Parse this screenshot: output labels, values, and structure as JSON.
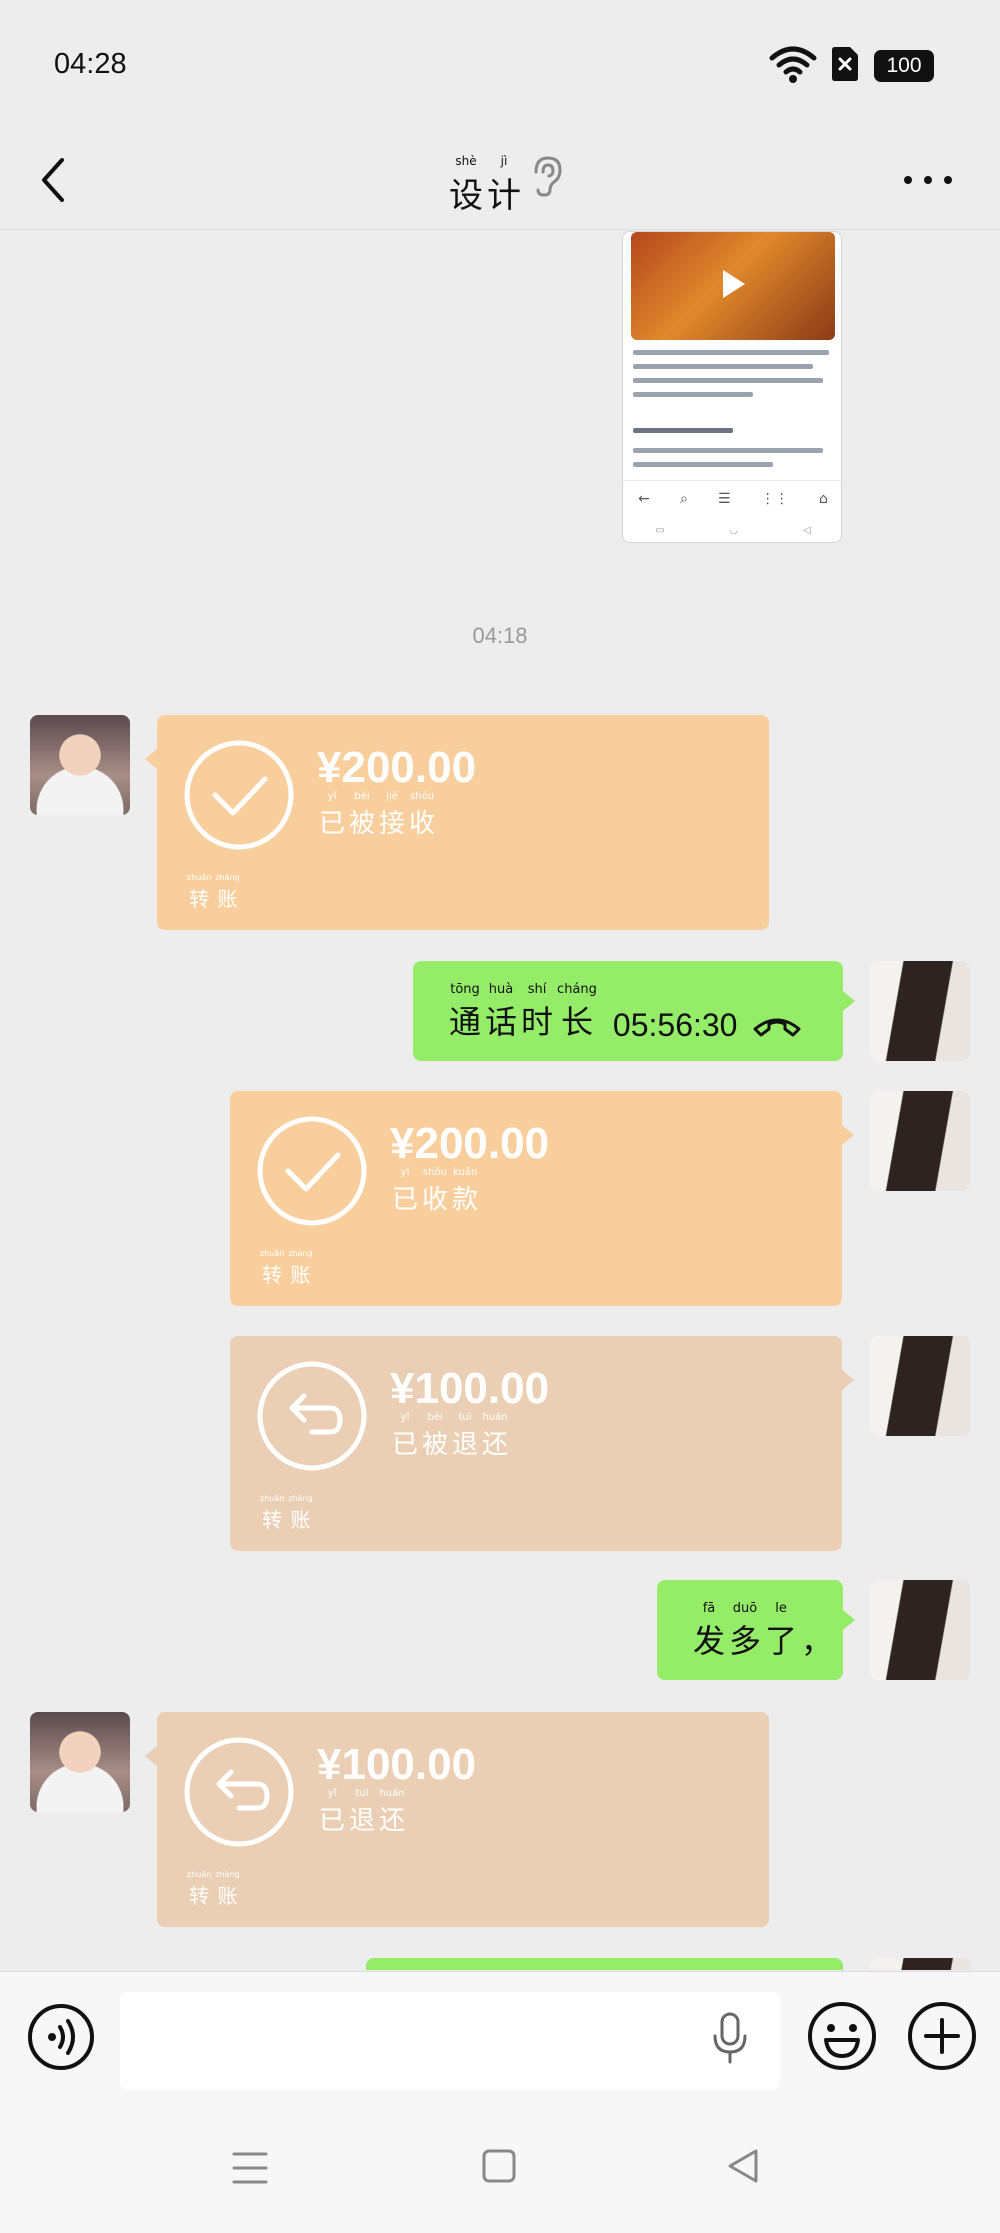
{
  "status_bar": {
    "time": "04:28",
    "battery": "100"
  },
  "header": {
    "title": [
      {
        "pinyin": "shè",
        "hanzi": "设"
      },
      {
        "pinyin": "jì",
        "hanzi": "计"
      }
    ]
  },
  "screenshot_nav": [
    "←",
    "⌕",
    "☰",
    "⋮⋮",
    "⌂"
  ],
  "screenshot_sys": [
    "▭",
    "◡",
    "◁"
  ],
  "timestamp": "04:18",
  "messages": {
    "t1": {
      "amount": "¥200.00",
      "status": [
        {
          "pinyin": "yǐ",
          "hanzi": "已"
        },
        {
          "pinyin": "bèi",
          "hanzi": "被"
        },
        {
          "pinyin": "jiē",
          "hanzi": "接"
        },
        {
          "pinyin": "shōu",
          "hanzi": "收"
        }
      ],
      "label": [
        {
          "pinyin": "zhuǎn",
          "hanzi": "转"
        },
        {
          "pinyin": "zhàng",
          "hanzi": "账"
        }
      ]
    },
    "call": {
      "words": [
        {
          "pinyin": "tōng",
          "hanzi": "通"
        },
        {
          "pinyin": "huà",
          "hanzi": "话"
        },
        {
          "pinyin": "shí",
          "hanzi": "时"
        },
        {
          "pinyin": "cháng",
          "hanzi": "长"
        }
      ],
      "duration": "05:56:30"
    },
    "t2": {
      "amount": "¥200.00",
      "status": [
        {
          "pinyin": "yǐ",
          "hanzi": "已"
        },
        {
          "pinyin": "shōu",
          "hanzi": "收"
        },
        {
          "pinyin": "kuǎn",
          "hanzi": "款"
        }
      ],
      "label": [
        {
          "pinyin": "zhuǎn",
          "hanzi": "转"
        },
        {
          "pinyin": "zhàng",
          "hanzi": "账"
        }
      ]
    },
    "t3": {
      "amount": "¥100.00",
      "status": [
        {
          "pinyin": "yǐ",
          "hanzi": "已"
        },
        {
          "pinyin": "bèi",
          "hanzi": "被"
        },
        {
          "pinyin": "tuì",
          "hanzi": "退"
        },
        {
          "pinyin": "huán",
          "hanzi": "还"
        }
      ],
      "label": [
        {
          "pinyin": "zhuǎn",
          "hanzi": "转"
        },
        {
          "pinyin": "zhàng",
          "hanzi": "账"
        }
      ]
    },
    "text1": {
      "words": [
        {
          "pinyin": "fā",
          "hanzi": "发"
        },
        {
          "pinyin": "duō",
          "hanzi": "多"
        },
        {
          "pinyin": "le",
          "hanzi": "了"
        },
        {
          "pinyin": "",
          "hanzi": "，"
        }
      ]
    },
    "t4": {
      "amount": "¥100.00",
      "status": [
        {
          "pinyin": "yǐ",
          "hanzi": "已"
        },
        {
          "pinyin": "tuì",
          "hanzi": "退"
        },
        {
          "pinyin": "huán",
          "hanzi": "还"
        }
      ],
      "label": [
        {
          "pinyin": "zhuǎn",
          "hanzi": "转"
        },
        {
          "pinyin": "zhàng",
          "hanzi": "账"
        }
      ]
    }
  },
  "colors": {
    "transfer_orange": "#f9ce9d",
    "transfer_tan": "#ebcfb4",
    "sent_green": "#95ec69",
    "background": "#ededed"
  }
}
